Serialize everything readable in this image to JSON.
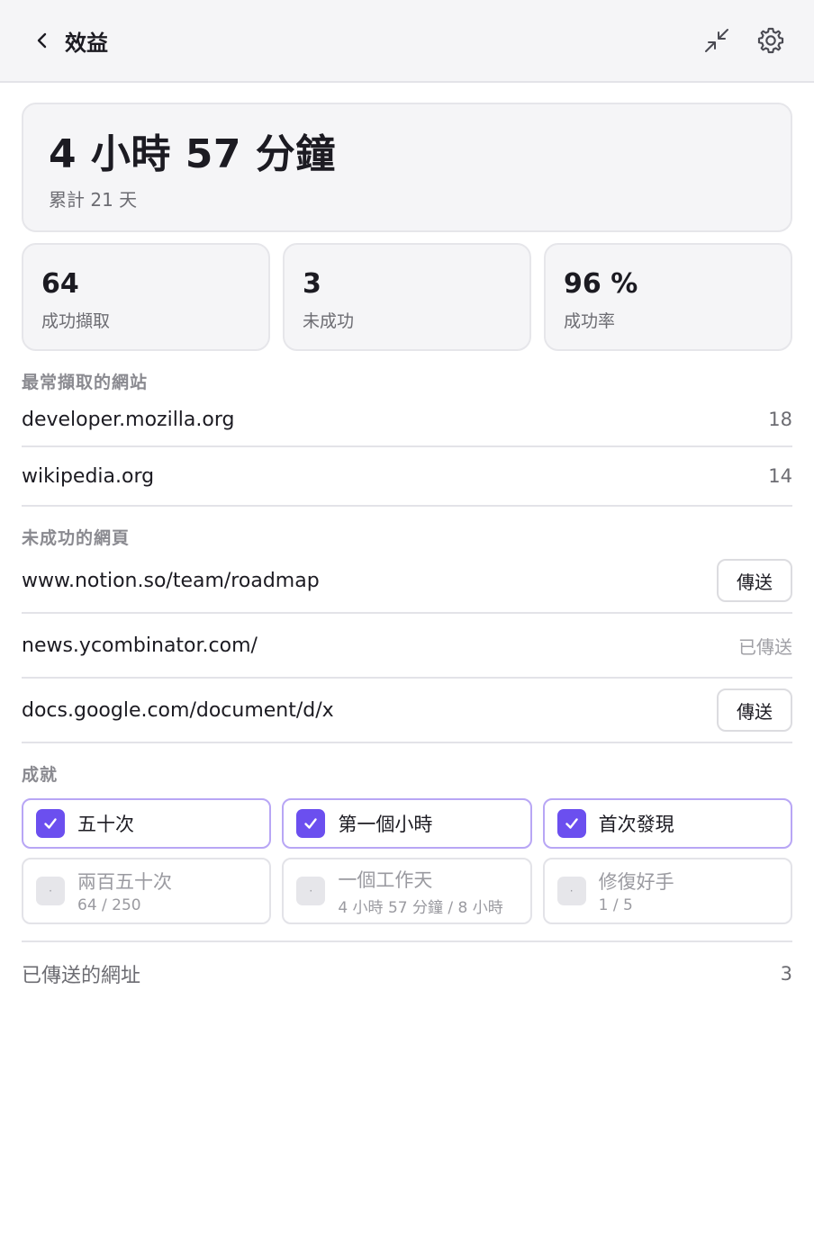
{
  "header": {
    "title": "效益",
    "back_icon": "chevron-left-icon",
    "collapse_icon": "collapse-arrows-icon",
    "settings_icon": "gear-icon"
  },
  "total": {
    "time": "4 小時 57 分鐘",
    "days": "累計 21 天"
  },
  "stats": [
    {
      "value": "64",
      "label": "成功擷取"
    },
    {
      "value": "3",
      "label": "未成功"
    },
    {
      "value": "96 %",
      "label": "成功率"
    }
  ],
  "top_sites": {
    "title": "最常擷取的網站",
    "items": [
      {
        "site": "developer.mozilla.org",
        "count": "18"
      },
      {
        "site": "wikipedia.org",
        "count": "14"
      }
    ]
  },
  "failed_pages": {
    "title": "未成功的網頁",
    "send_label": "傳送",
    "sent_label": "已傳送",
    "items": [
      {
        "url": "www.notion.so/team/roadmap",
        "sent": false
      },
      {
        "url": "news.ycombinator.com/",
        "sent": true
      },
      {
        "url": "docs.google.com/document/d/x",
        "sent": false
      }
    ]
  },
  "achievements": {
    "title": "成就",
    "done": [
      {
        "name": "五十次"
      },
      {
        "name": "第一個小時"
      },
      {
        "name": "首次發現"
      }
    ],
    "todo": [
      {
        "name": "兩百五十次",
        "progress": "64 / 250"
      },
      {
        "name": "一個工作天",
        "progress": "4 小時 57 分鐘 / 8 小時"
      },
      {
        "name": "修復好手",
        "progress": "1 / 5"
      }
    ]
  },
  "footer": {
    "label": "已傳送的網址",
    "value": "3"
  },
  "colors": {
    "accent": "#6b4fef",
    "accent_border": "#b8a6f5"
  }
}
